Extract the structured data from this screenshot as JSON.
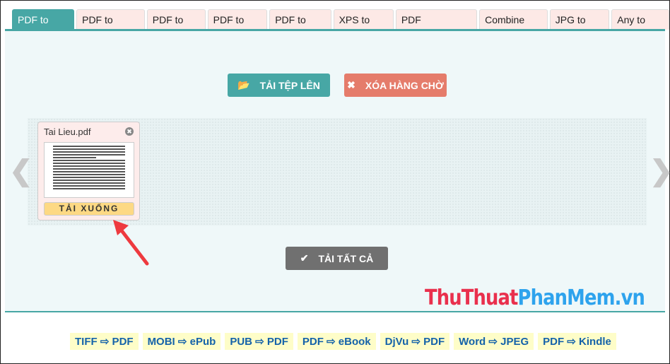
{
  "tabs": [
    {
      "label": "PDF to DOC",
      "active": true
    },
    {
      "label": "PDF to DOCX"
    },
    {
      "label": "PDF to Text"
    },
    {
      "label": "PDF to JPG"
    },
    {
      "label": "PDF to PNG"
    },
    {
      "label": "XPS to PDF"
    },
    {
      "label": "PDF Compressor"
    },
    {
      "label": "Combine PDF"
    },
    {
      "label": "JPG to PDF"
    },
    {
      "label": "Any to PDF"
    }
  ],
  "buttons": {
    "upload": "TẢI TỆP LÊN",
    "clear": "XÓA HÀNG CHỜ",
    "download_all": "TẢI TẤT CẢ"
  },
  "file": {
    "name": "Tai Lieu.pdf",
    "download": "TẢI XUỐNG"
  },
  "nav": {
    "prev": "❮",
    "next": "❯"
  },
  "watermark": {
    "part1": "ThuThuat",
    "part2": "PhanMem",
    "part3": ".vn"
  },
  "footer_links": [
    "TIFF ⇨ PDF",
    "MOBI ⇨ ePub",
    "PUB ⇨ PDF",
    "PDF ⇨ eBook",
    "DjVu ⇨ PDF",
    "Word ⇨ JPEG",
    "PDF ⇨ Kindle"
  ],
  "colors": {
    "accent": "#47a7a5",
    "danger": "#e57c6b",
    "download": "#fdd984",
    "link": "#1462a9"
  }
}
